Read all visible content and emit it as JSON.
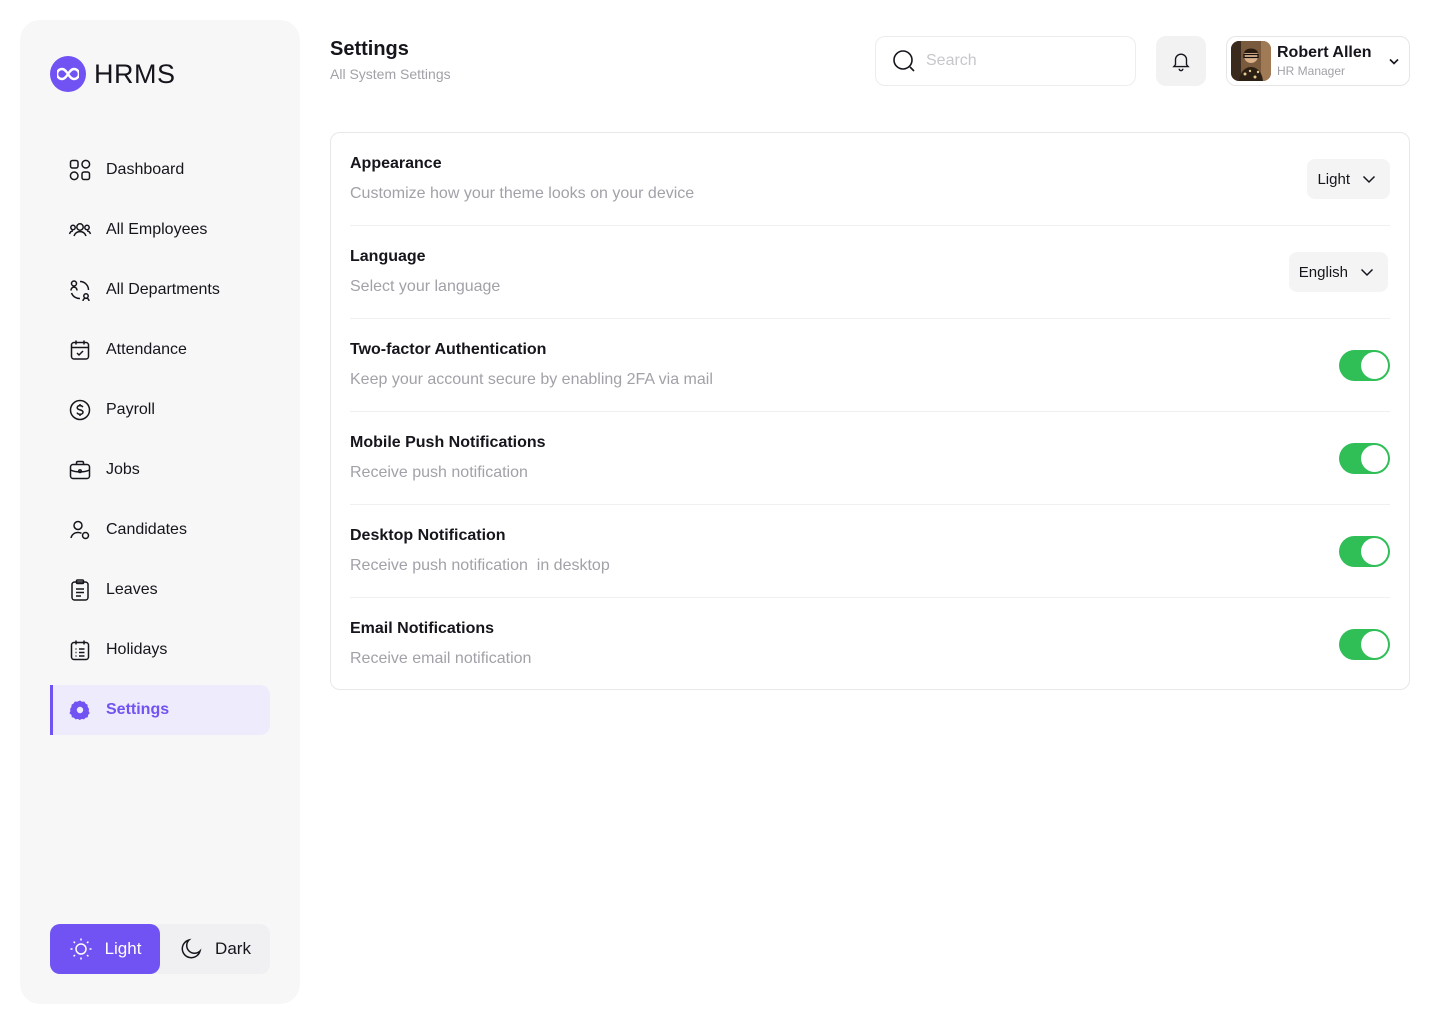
{
  "brand": {
    "name": "HRMS",
    "accent": "#7152F3"
  },
  "sidebar": {
    "items": [
      {
        "label": "Dashboard",
        "icon": "grid-icon"
      },
      {
        "label": "All Employees",
        "icon": "users-icon"
      },
      {
        "label": "All Departments",
        "icon": "departments-icon"
      },
      {
        "label": "Attendance",
        "icon": "calendar-check-icon"
      },
      {
        "label": "Payroll",
        "icon": "dollar-circle-icon"
      },
      {
        "label": "Jobs",
        "icon": "briefcase-icon"
      },
      {
        "label": "Candidates",
        "icon": "user-icon"
      },
      {
        "label": "Leaves",
        "icon": "clipboard-icon"
      },
      {
        "label": "Holidays",
        "icon": "calendar-list-icon"
      },
      {
        "label": "Settings",
        "icon": "gear-icon",
        "active": true
      }
    ],
    "theme": {
      "light_label": "Light",
      "dark_label": "Dark",
      "selected": "Light"
    }
  },
  "header": {
    "title": "Settings",
    "subtitle": "All System Settings",
    "search_placeholder": "Search",
    "user": {
      "name": "Robert Allen",
      "role": "HR Manager"
    }
  },
  "settings": [
    {
      "title": "Appearance",
      "desc": "Customize how your theme looks on your device",
      "control": "select",
      "value": "Light"
    },
    {
      "title": "Language",
      "desc": "Select your language",
      "control": "select",
      "value": "English"
    },
    {
      "title": "Two-factor Authentication",
      "desc": "Keep your account secure by enabling 2FA via mail",
      "control": "toggle",
      "on": true
    },
    {
      "title": "Mobile Push Notifications",
      "desc": "Receive push notification",
      "control": "toggle",
      "on": true
    },
    {
      "title": "Desktop Notification",
      "desc": "Receive push notification  in desktop",
      "control": "toggle",
      "on": true
    },
    {
      "title": "Email Notifications",
      "desc": "Receive email notification",
      "control": "toggle",
      "on": true
    }
  ],
  "colors": {
    "toggle_on": "#30BE57",
    "muted_text": "#A2A1A8"
  }
}
